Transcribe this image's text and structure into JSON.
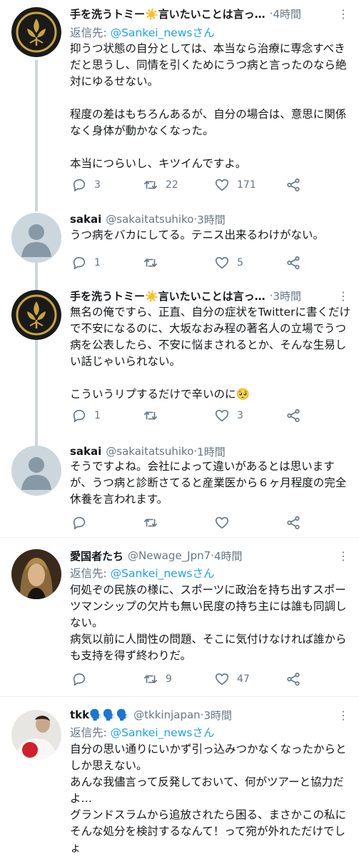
{
  "tweets": [
    {
      "name": "手を洗うトミー☀️言いたいことは言っ…",
      "time": "4時間",
      "reply_prefix": "返信先: ",
      "reply_link": "@Sankei_newsさん",
      "body": "抑うつ状態の自分としては、本当なら治療に専念すべきだと思うし、同情を引くためにうつ病と言ったのなら絶対にゆるせない。\n\n程度の差はもちろんあるが、自分の場合は、意思に関係なく身体が動かなくなった。\n\n本当につらいし、キツイんですよ。",
      "replies": "3",
      "retweets": "22",
      "likes": "171"
    },
    {
      "name": "sakai",
      "handle": "@sakaitatsuhiko",
      "time": "3時間",
      "body": "うつ病をバカにしてる。テニス出来るわけがない。",
      "replies": "1",
      "retweets": "",
      "likes": "5"
    },
    {
      "name": "手を洗うトミー☀️言いたいことは言っ…",
      "time": "3時間",
      "body": "無名の俺ですら、正直、自分の症状をTwitterに書くだけで不安になるのに、大坂なおみ程の著名人の立場でうつ病を公表したら、不安に悩まされるとか、そんな生易しい話じゃいられない。\n\nこういうリプするだけで辛いのに🥺",
      "replies": "1",
      "retweets": "",
      "likes": "3"
    },
    {
      "name": "sakai",
      "handle": "@sakaitatsuhiko",
      "time": "1時間",
      "body": "そうですよね。会社によって違いがあるとは思いますが、うつ病と診断さてると産業医から６ヶ月程度の完全休養を言われます。",
      "replies": "",
      "retweets": "",
      "likes": ""
    },
    {
      "name": "愛国者たち",
      "handle": "@Newage_Jpn7",
      "time": "4時間",
      "reply_prefix": "返信先: ",
      "reply_link": "@Sankei_newsさん",
      "body": "何処ぞの民族の様に、スポーツに政治を持ち出すスポーツマンシップの欠片も無い民度の持ち主には誰も同調しない。\n病気以前に人間性の問題、そこに気付けなければ誰からも支持を得ず終わりだ。",
      "replies": "",
      "retweets": "9",
      "likes": "47"
    },
    {
      "name": "tkk🗣️🗣️🗣️",
      "handle": "@tkkinjapan",
      "time": "3時間",
      "reply_prefix": "返信先: ",
      "reply_link": "@Sankei_newsさん",
      "body": "自分の思い通りにいかず引っ込みつかなくなったからとしか思えない。\nあんな我儘言って反発しておいて、何がツアーと協力だよ…\nグランドスラムから追放されたら困る、まさかこの私にそんな処分を検討するなんて！って宛が外れただけでしょ"
    }
  ],
  "separator": " · ",
  "more_icon": "⋮",
  "colors": {
    "link": "#1da1f2",
    "muted": "#657786",
    "thread_line": "#ccd6dd",
    "divider": "#e6ecf0"
  }
}
